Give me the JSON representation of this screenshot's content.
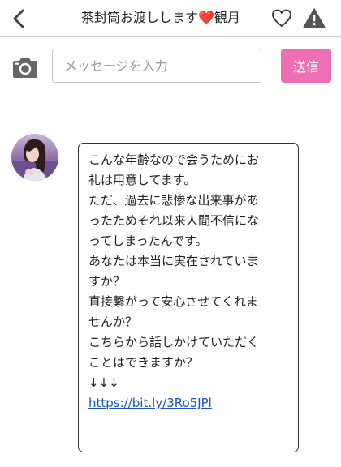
{
  "header": {
    "title": "茶封筒お渡しします❤️観月",
    "back_icon": "chevron-left-icon",
    "favorite_icon": "heart-outline-icon",
    "report_icon": "warning-icon"
  },
  "composer": {
    "camera_icon": "camera-icon",
    "placeholder": "メッセージを入力",
    "value": "",
    "send_label": "送信",
    "send_color": "#ee6fb3"
  },
  "message": {
    "lines": [
      "こんな年齢なので会うためにお",
      "礼は用意してます。",
      "ただ、過去に悲惨な出来事があ",
      "ったためそれ以来人間不信にな",
      "ってしまったんです。",
      "あなたは本当に実在されていま",
      "すか？",
      "直接繋がって安心させてくれま",
      "せんか？",
      "こちらから話しかけていただく",
      "ことはできますか？",
      "↓↓↓"
    ],
    "link": "https://bit.ly/3Ro5JPl"
  }
}
